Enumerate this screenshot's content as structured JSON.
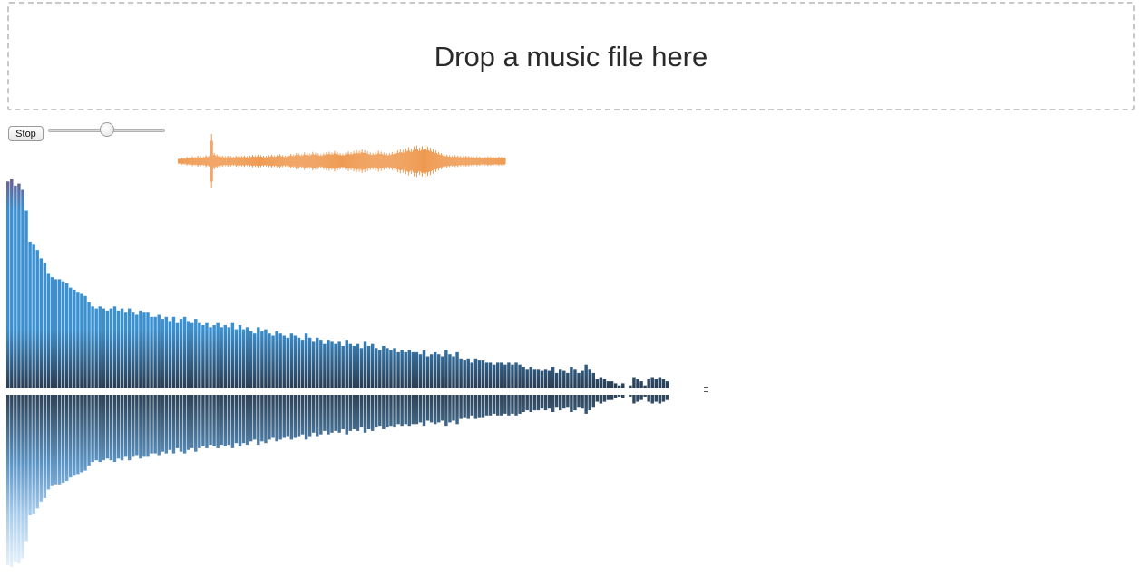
{
  "dropzone": {
    "label": "Drop a music file here"
  },
  "controls": {
    "stop_label": "Stop",
    "volume": 0.5
  },
  "colors": {
    "waveform": "#ef9a52",
    "spectrum_top": "#6a5f90",
    "spectrum_mid": "#3a90d0",
    "spectrum_bottom": "#2a3e55",
    "reflection_top": "#2d4358",
    "reflection_bottom": "#e8f2fb",
    "dropzone_border": "#c8c8c8"
  },
  "icons": {
    "slider_thumb": "circle-thumb"
  },
  "chart_data": {
    "type": "bar",
    "values": [
      0.99,
      1.0,
      0.97,
      0.98,
      0.95,
      0.85,
      0.7,
      0.69,
      0.66,
      0.62,
      0.6,
      0.55,
      0.53,
      0.52,
      0.52,
      0.51,
      0.5,
      0.48,
      0.47,
      0.46,
      0.45,
      0.44,
      0.41,
      0.39,
      0.38,
      0.39,
      0.38,
      0.37,
      0.38,
      0.39,
      0.37,
      0.38,
      0.36,
      0.38,
      0.36,
      0.35,
      0.37,
      0.36,
      0.36,
      0.34,
      0.34,
      0.35,
      0.33,
      0.34,
      0.32,
      0.34,
      0.31,
      0.33,
      0.34,
      0.32,
      0.31,
      0.33,
      0.31,
      0.3,
      0.31,
      0.29,
      0.3,
      0.31,
      0.29,
      0.3,
      0.29,
      0.31,
      0.28,
      0.3,
      0.28,
      0.29,
      0.27,
      0.26,
      0.29,
      0.27,
      0.28,
      0.26,
      0.25,
      0.27,
      0.26,
      0.25,
      0.24,
      0.26,
      0.25,
      0.24,
      0.23,
      0.26,
      0.24,
      0.22,
      0.24,
      0.23,
      0.21,
      0.23,
      0.22,
      0.21,
      0.22,
      0.2,
      0.23,
      0.21,
      0.2,
      0.21,
      0.19,
      0.22,
      0.2,
      0.21,
      0.19,
      0.18,
      0.2,
      0.19,
      0.18,
      0.19,
      0.17,
      0.18,
      0.17,
      0.18,
      0.17,
      0.17,
      0.16,
      0.18,
      0.15,
      0.16,
      0.17,
      0.16,
      0.15,
      0.18,
      0.16,
      0.15,
      0.17,
      0.14,
      0.13,
      0.14,
      0.12,
      0.14,
      0.13,
      0.13,
      0.12,
      0.12,
      0.11,
      0.12,
      0.12,
      0.11,
      0.12,
      0.11,
      0.12,
      0.11,
      0.1,
      0.09,
      0.1,
      0.09,
      0.09,
      0.08,
      0.09,
      0.08,
      0.1,
      0.07,
      0.09,
      0.08,
      0.07,
      0.1,
      0.09,
      0.07,
      0.08,
      0.11,
      0.09,
      0.07,
      0.04,
      0.05,
      0.04,
      0.03,
      0.03,
      0.02,
      0.01,
      0.02,
      0.0,
      0.01,
      0.05,
      0.04,
      0.03,
      0.01,
      0.04,
      0.05,
      0.04,
      0.05,
      0.04,
      0.03
    ],
    "ylim": [
      0,
      1
    ],
    "grid": false,
    "waveform": [
      0.1,
      0.14,
      0.12,
      0.16,
      0.15,
      0.18,
      0.16,
      0.2,
      0.18,
      0.17,
      0.22,
      0.2,
      1.0,
      0.3,
      0.25,
      0.22,
      0.2,
      0.18,
      0.2,
      0.19,
      0.17,
      0.2,
      0.22,
      0.19,
      0.21,
      0.18,
      0.2,
      0.23,
      0.21,
      0.24,
      0.22,
      0.2,
      0.19,
      0.22,
      0.24,
      0.21,
      0.23,
      0.26,
      0.22,
      0.2,
      0.24,
      0.27,
      0.25,
      0.3,
      0.28,
      0.26,
      0.32,
      0.3,
      0.28,
      0.34,
      0.31,
      0.29,
      0.26,
      0.3,
      0.33,
      0.35,
      0.32,
      0.38,
      0.34,
      0.3,
      0.28,
      0.31,
      0.36,
      0.33,
      0.37,
      0.41,
      0.38,
      0.43,
      0.4,
      0.36,
      0.32,
      0.3,
      0.34,
      0.38,
      0.35,
      0.32,
      0.28,
      0.3,
      0.33,
      0.36,
      0.4,
      0.44,
      0.42,
      0.48,
      0.52,
      0.46,
      0.55,
      0.58,
      0.5,
      0.56,
      0.6,
      0.54,
      0.5,
      0.45,
      0.4,
      0.34,
      0.3,
      0.26,
      0.24,
      0.22,
      0.2,
      0.22,
      0.21,
      0.19,
      0.18,
      0.2,
      0.19,
      0.17,
      0.16,
      0.18,
      0.17,
      0.15,
      0.16,
      0.18,
      0.17,
      0.16,
      0.15,
      0.17,
      0.16,
      0.15
    ]
  }
}
